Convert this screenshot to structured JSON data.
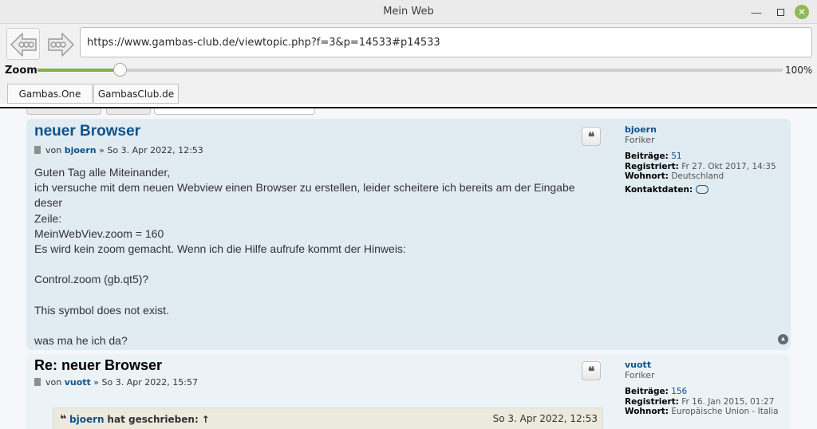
{
  "window": {
    "title": "Mein Web"
  },
  "toolbar": {
    "url": "https://www.gambas-club.de/viewtopic.php?f=3&p=14533#p14533",
    "zoom_label": "Zoom",
    "zoom_value": 0.11,
    "zoom_percent": "100%",
    "tabs": [
      "Gambas.One",
      "GambasClub.de"
    ]
  },
  "posts": [
    {
      "title": "neuer Browser",
      "meta_prefix": "von",
      "author": "bjoern",
      "meta_suffix": "» So 3. Apr 2022, 12:53",
      "body": [
        "Guten Tag alle Miteinander,",
        "ich versuche mit dem neuen Webview einen Browser zu erstellen, leider scheitere ich bereits am der Eingabe deser",
        "Zeile:",
        "MeinWebViev.zoom = 160",
        "Es wird kein zoom gemacht. Wenn ich die Hilfe aufrufe kommt der Hinweis:",
        "",
        "Control.zoom (gb.qt5)?",
        "",
        "This symbol does not exist.",
        "",
        "was ma he ich da?"
      ],
      "profile": {
        "username": "bjoern",
        "rank": "Foriker",
        "posts_label": "Beiträge:",
        "posts_value": "51",
        "registered_label": "Registriert:",
        "registered_value": "Fr 27. Okt 2017, 14:35",
        "location_label": "Wohnort:",
        "location_value": "Deutschland",
        "contact_label": "Kontaktdaten:"
      }
    },
    {
      "title": "Re: neuer Browser",
      "meta_prefix": "von",
      "author": "vuott",
      "meta_suffix": "» So 3. Apr 2022, 15:57",
      "quote": {
        "user": "bjoern",
        "wrote": "hat geschrieben:",
        "arrow": "↑",
        "date": "So 3. Apr 2022, 12:53"
      },
      "profile": {
        "username": "vuott",
        "rank": "Foriker",
        "posts_label": "Beiträge:",
        "posts_value": "156",
        "registered_label": "Registriert:",
        "registered_value": "Fr 16. Jan 2015, 01:27",
        "location_label": "Wohnort:",
        "location_value": "Europäische Union - Italia"
      }
    }
  ]
}
